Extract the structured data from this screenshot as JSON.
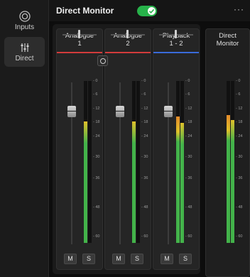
{
  "nav": {
    "items": [
      {
        "label": "Inputs",
        "icon": "inputs-icon",
        "active": false
      },
      {
        "label": "Direct",
        "icon": "mixer-sliders-icon",
        "active": true
      }
    ]
  },
  "header": {
    "title": "Direct Monitor",
    "toggle_on": true,
    "more_label": "···"
  },
  "meter_scale": [
    "0",
    "6",
    "12",
    "18",
    "24",
    "30",
    "36",
    "48",
    "60"
  ],
  "channels": [
    {
      "name_line1": "Analogue",
      "name_line2": "1",
      "underline_color": "#d23b3b",
      "mute_label": "M",
      "solo_label": "S",
      "meter_levels": [
        0.75,
        0
      ]
    },
    {
      "name_line1": "Analogue",
      "name_line2": "2",
      "underline_color": "#d23b3b",
      "mute_label": "M",
      "solo_label": "S",
      "meter_levels": [
        0.75,
        0
      ]
    },
    {
      "name_line1": "Playback",
      "name_line2": "1 - 2",
      "underline_color": "#3a6bd9",
      "mute_label": "M",
      "solo_label": "S",
      "meter_levels": [
        0.78,
        0.74
      ]
    }
  ],
  "direct_monitor": {
    "name_line1": "Direct",
    "name_line2": "Monitor",
    "meter_levels": [
      0.79,
      0.76
    ]
  },
  "colors": {
    "accent_green": "#27b24a",
    "meter_green": "#43b34a",
    "meter_yellow": "#e0c02a",
    "meter_orange": "#e58a2a"
  }
}
